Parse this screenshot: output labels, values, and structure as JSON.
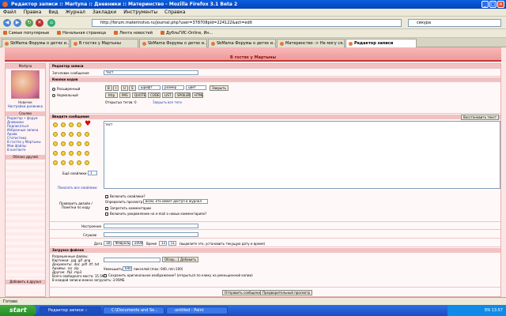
{
  "window": {
    "title": "Редактор записи :: Martyna :: Дневники :: Материнство - Mozilla Firefox 3.1 Beta 2"
  },
  "menu": [
    "Файл",
    "Правка",
    "Вид",
    "Журнал",
    "Закладки",
    "Инструменты",
    "Справка"
  ],
  "nav": {
    "url": "http://forum.materinstvo.ru/journal.php?user=378708pid=224122&act=edit",
    "search": "секура"
  },
  "bookmarks": [
    "Самые популярные",
    "Начальная страница",
    "Лента новостей",
    "ДубльГИС-Online, Ин..."
  ],
  "tabs": [
    "SbMama Форумы о детях и...",
    "В гостях у Мартыны",
    "SbMama Форумы о детях и...",
    "SbMama Форумы о детях и...",
    "Материнство -> Не могу ся...",
    "Редактор записи"
  ],
  "page": {
    "banner": "В гостях у Мартыны",
    "sidebar": {
      "header": "Martyna",
      "status": "Новичок",
      "link": "Настройки дневника",
      "sec1": "Ссылки",
      "items1": [
        "Редактор • форум",
        "Дневники",
        "Подписаться",
        "Избранные записи",
        "Архив",
        "Статистика",
        "В гостях у Мартыны",
        "Мои файлы",
        "В контакте"
      ],
      "sec2": "Облако друзей",
      "sec3": "Добавить в друзья"
    },
    "form": {
      "sec_editor": "Редактор записи",
      "title_label": "Заголовок сообщения",
      "title_value": "тест",
      "sec_codes": "Кнопки кодов",
      "mode_advanced": "Расширенный",
      "mode_normal": "Нормальный",
      "font_size": "размер",
      "font_face": "шрифт",
      "font_color": "цвет",
      "close_all": "Закрыть",
      "btns": [
        "B",
        "I",
        "U",
        "S",
        "http",
        "IMG",
        "QUOTE",
        "CODE",
        "LIST",
        "SPOILER",
        "HTML"
      ],
      "open_tags": "Открытых тегов: 0",
      "close_hint": "Закрыть все теги",
      "sec_message": "Введите сообщение",
      "restore_btn": "Восстановить текст",
      "message": "тест",
      "smilies_label": "Ещё смайлики",
      "smilies_count": "1",
      "show_all_smilies": "Показать все смайлики",
      "sec_options": "Проверить дизайн / Пометки по коду",
      "opt1": "Включить смайлики?",
      "opt2_label": "Определить просмотр:",
      "opt2_value": "всем, кто имеет доступ в журнал",
      "opt3": "Запретить комментарии",
      "opt4": "Включить уведомление на e-mail о новых комментариях?",
      "mood_label": "Настроение",
      "music_label": "Слушаю",
      "date_label": "Дата",
      "date_day": "18",
      "date_month": "Февраль",
      "date_year": "2009",
      "time_label": "Время",
      "time_h": "13",
      "time_m": "51",
      "date_hint": "(выделите это, установить текущую дату и время)",
      "sec_files": "Загрузка файлов",
      "files_info": [
        "Разрешенные файлы:",
        "Картинки: .jpg .gif .png",
        "Документы: .doc .pdf .rtf .txt",
        "Архивы: .rar .zip",
        "Другие: .fb2 .mp3",
        "Всего свободного места: 15.5МБ",
        "В каждой записи можно загрузить: 3.95МБ"
      ],
      "browse_btn": "Обзор...",
      "add_btn": "Добавить",
      "thumb_label": "Уменьшить до",
      "thumb_val": "640",
      "thumb_hint": "пикселей (max: 640, min:100)",
      "upload_note": "Сохранить оригинальное изображение? (открыться по клику на уменьшенной копии)",
      "submit": "Отправить сообщение",
      "preview": "Предварительный просмотр"
    }
  },
  "status": "Готово",
  "taskbar": {
    "start": "start",
    "items": [
      "Редактор записи ::",
      "C:\\Documents and Se...",
      "untitled - Paint"
    ],
    "tray": "EN  13:57"
  }
}
